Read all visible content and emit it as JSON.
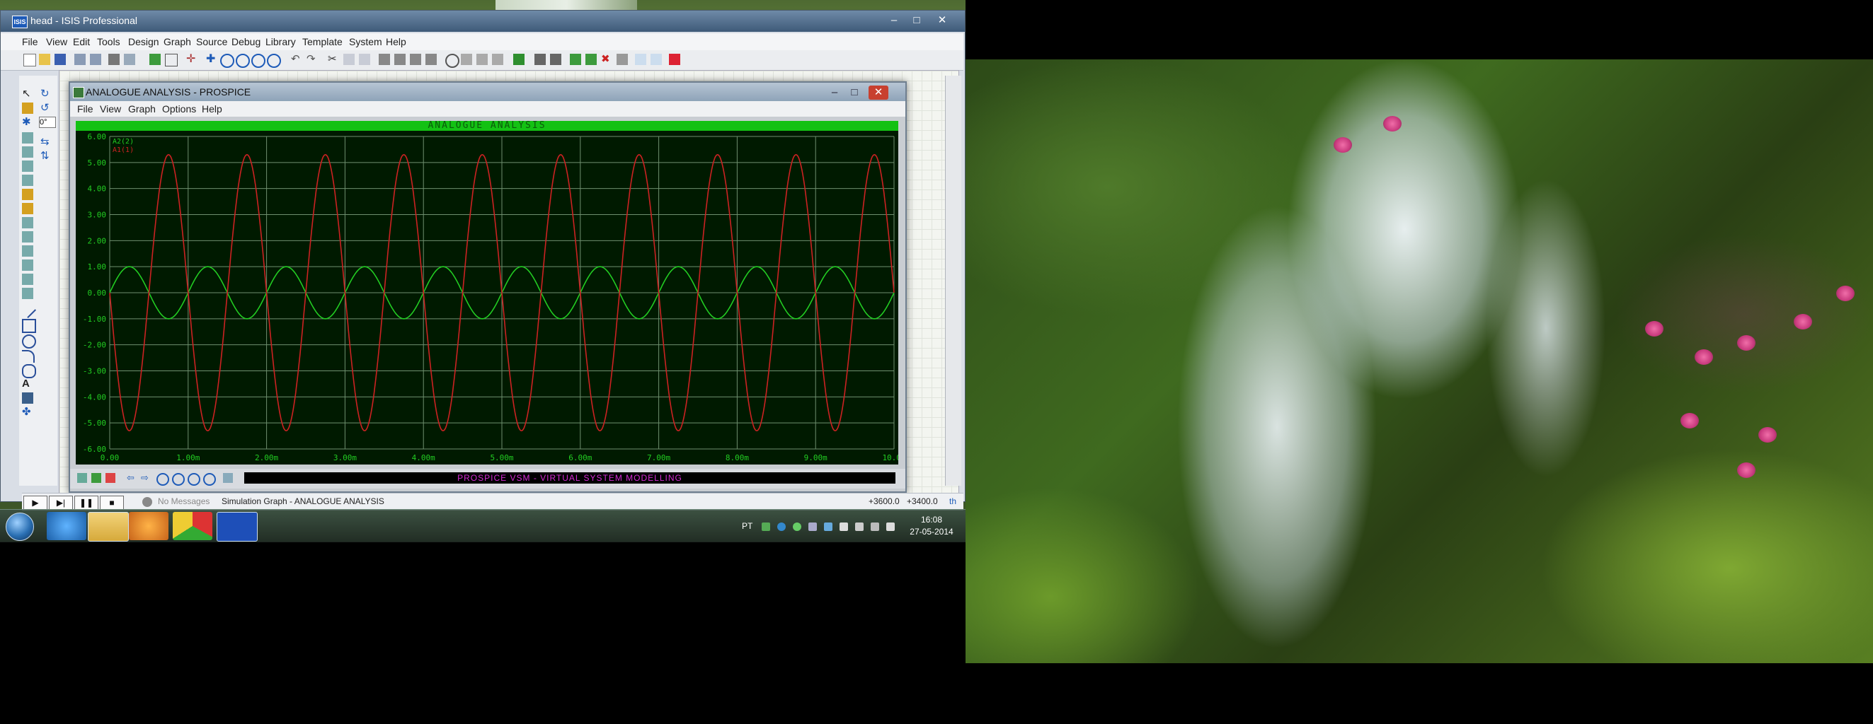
{
  "isis": {
    "title": "head - ISIS Professional",
    "menu": [
      "File",
      "View",
      "Edit",
      "Tools",
      "Design",
      "Graph",
      "Source",
      "Debug",
      "Library",
      "Template",
      "System",
      "Help"
    ],
    "zoom_box": "0°",
    "status": {
      "message": "No Messages",
      "description": "Simulation Graph - ANALOGUE ANALYSIS",
      "coord_x": "+3600.0",
      "coord_y": "+3400.0",
      "units": "th"
    },
    "sim_controls": [
      "play",
      "step",
      "pause",
      "stop"
    ]
  },
  "prospice": {
    "title": "ANALOGUE ANALYSIS - PROSPICE",
    "menu": [
      "File",
      "View",
      "Graph",
      "Options",
      "Help"
    ],
    "graph_title": "ANALOGUE ANALYSIS",
    "banner": "PROSPICE VSM - VIRTUAL SYSTEM MODELLING"
  },
  "chart_data": {
    "type": "line",
    "title": "ANALOGUE ANALYSIS",
    "x_ticks": [
      "0.00",
      "1.00m",
      "2.00m",
      "3.00m",
      "4.00m",
      "5.00m",
      "6.00m",
      "7.00m",
      "8.00m",
      "9.00m",
      "10.0m"
    ],
    "y_ticks": [
      "6.00",
      "5.00",
      "4.00",
      "3.00",
      "2.00",
      "1.00",
      "0.00",
      "-1.00",
      "-2.00",
      "-3.00",
      "-4.00",
      "-5.00",
      "-6.00"
    ],
    "xlim": [
      0,
      0.01
    ],
    "ylim": [
      -6,
      6
    ],
    "grid": true,
    "legend": "top-left",
    "series": [
      {
        "name": "A2(2)",
        "color": "#22cc22",
        "amplitude": 1.0,
        "frequency_hz": 1000,
        "phase_deg": 0
      },
      {
        "name": "A1(1)",
        "color": "#cc2222",
        "amplitude": 5.3,
        "frequency_hz": 1000,
        "phase_deg": 180
      }
    ]
  },
  "taskbar": {
    "language": "PT",
    "time": "16:08",
    "date": "27-05-2014",
    "apps": [
      "explorer",
      "ie",
      "folder",
      "media",
      "chrome",
      "isis"
    ]
  }
}
